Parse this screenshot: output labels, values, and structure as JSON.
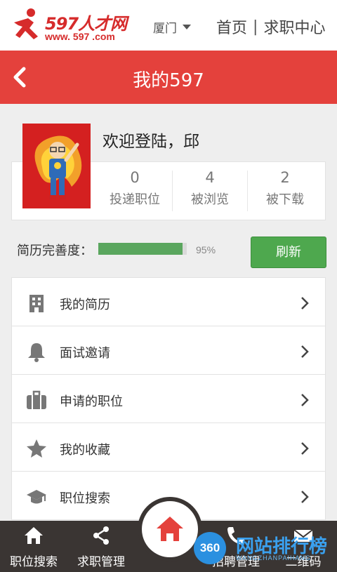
{
  "header": {
    "logo_title": "597人才网",
    "logo_url": "www. 597 .com",
    "city": "厦门",
    "nav_home": "首页",
    "nav_sep": "|",
    "nav_job_center": "求职中心"
  },
  "titlebar": {
    "title": "我的597"
  },
  "profile": {
    "welcome": "欢迎登陆，邱",
    "stats": [
      {
        "value": "0",
        "label": "投递职位"
      },
      {
        "value": "4",
        "label": "被浏览"
      },
      {
        "value": "2",
        "label": "被下载"
      }
    ]
  },
  "completion": {
    "label": "简历完善度：",
    "percent_text": "95%",
    "percent": 95,
    "refresh_label": "刷新"
  },
  "menu": {
    "items": [
      {
        "label": "我的简历",
        "icon": "building-icon"
      },
      {
        "label": "面试邀请",
        "icon": "bell-icon"
      },
      {
        "label": "申请的职位",
        "icon": "briefcase-icon"
      },
      {
        "label": "我的收藏",
        "icon": "star-icon"
      },
      {
        "label": "职位搜索",
        "icon": "graduation-cap-icon"
      }
    ]
  },
  "bottom_nav": {
    "items": [
      {
        "label": "职位搜索",
        "icon": "home-icon"
      },
      {
        "label": "求职管理",
        "icon": "share-icon"
      },
      {
        "label": "招聘管理",
        "icon": "phone-icon"
      },
      {
        "label": "二维码",
        "icon": "mail-icon"
      }
    ],
    "center_icon": "home-icon"
  },
  "watermark": {
    "badge": "360",
    "title": "网站排行榜",
    "sub": "WANGZHANPAIHANG"
  },
  "colors": {
    "brand_red": "#e4413c",
    "progress_green": "#5aa65e",
    "refresh_green": "#4ea84e",
    "bottom_bar": "#3a3533"
  }
}
